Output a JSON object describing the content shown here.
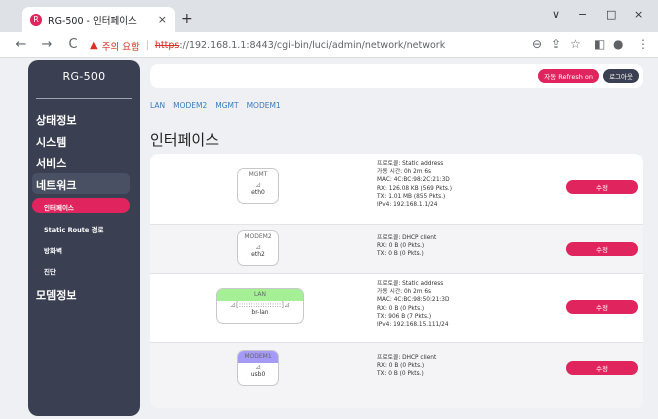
{
  "browser": {
    "tab_title": "RG-500 - 인터페이스",
    "tab_close": "×",
    "new_tab": "+",
    "favicon": "R",
    "win_controls": [
      "∨",
      "−",
      "□",
      "×"
    ],
    "nav": {
      "back": "←",
      "forward": "→",
      "reload": "C"
    },
    "security_warning": "주의 요함",
    "url_scheme": "https",
    "url_rest": "://192.168.1.1:8443/cgi-bin/luci/admin/network/network",
    "toolbar_icons": [
      "zoom-icon",
      "share-icon",
      "star-icon",
      "sidepanel-icon",
      "profile-icon",
      "menu-icon"
    ]
  },
  "sidebar": {
    "brand": "RG-500",
    "menu": [
      "상태정보",
      "시스템",
      "서비스",
      "네트워크",
      "모뎀정보"
    ],
    "submenu": [
      "인터페이스",
      "Static Route 경로",
      "방화벽",
      "진단"
    ]
  },
  "topbar": {
    "refresh_label": "자동 Refresh on",
    "logout_label": "로그아웃"
  },
  "tabs": [
    "LAN",
    "MODEM2",
    "MGMT",
    "MODEM1"
  ],
  "page_title": "인터페이스",
  "interfaces": [
    {
      "name": "MGMT",
      "device": "eth0",
      "header_color": "#ffffff",
      "details": [
        "프로토콜: Static address",
        "가동 시간: 0h 2m 6s",
        "MAC: 4C:BC:98:2C:21:3D",
        "RX: 126.08 KB (569 Pkts.)",
        "TX: 1.01 MB (855 Pkts.)",
        "IPv4: 192.168.1.1/24"
      ],
      "edit_label": "수정"
    },
    {
      "name": "MODEM2",
      "device": "eth2",
      "header_color": "#ffffff",
      "details": [
        "프로토콜: DHCP client",
        "RX: 0 B (0 Pkts.)",
        "TX: 0 B (0 Pkts.)"
      ],
      "edit_label": "수정"
    },
    {
      "name": "LAN",
      "device": "br-lan",
      "header_color": "#a5ef95",
      "details": [
        "프로토콜: Static address",
        "가동 시간: 0h 2m 6s",
        "MAC: 4C:BC:98:50:21:3D",
        "RX: 0 B (0 Pkts.)",
        "TX: 906 B (7 Pkts.)",
        "IPv4: 192.168.15.111/24"
      ],
      "edit_label": "수정"
    },
    {
      "name": "MODEM1",
      "device": "usb0",
      "header_color": "#a59af5",
      "details": [
        "프로토콜: DHCP client",
        "RX: 0 B (0 Pkts.)",
        "TX: 0 B (0 Pkts.)"
      ],
      "edit_label": "수정"
    }
  ],
  "colors": {
    "accent": "#e0245e",
    "sidebar": "#3a3f51",
    "link": "#3b7bbf"
  }
}
